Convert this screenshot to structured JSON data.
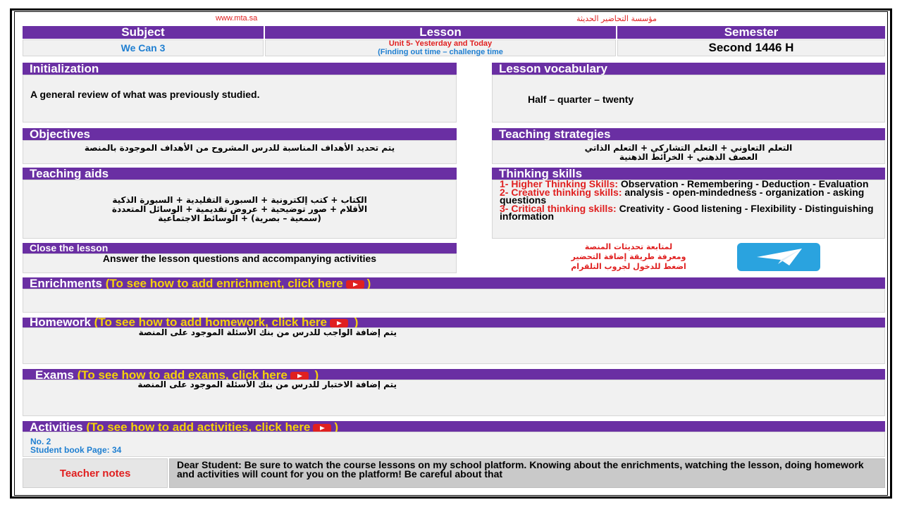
{
  "top": {
    "site": "www.mta.sa",
    "org": "مؤسسة التحاضير الحديثة"
  },
  "headers": {
    "subject": "Subject",
    "lesson": "Lesson",
    "semester": "Semester"
  },
  "info": {
    "subject": "We Can 3",
    "lesson_line1": "Unit 5- Yesterday and Today",
    "lesson_line2": "(Finding out time – challenge time",
    "semester": "Second 1446 H"
  },
  "initialization": {
    "title": "Initialization",
    "text": "A general review of what was previously studied."
  },
  "vocabulary": {
    "title": "Lesson vocabulary",
    "text": "Half – quarter – twenty"
  },
  "objectives": {
    "title": "Objectives",
    "text": "يتم تحديد الأهداف المناسبة للدرس المشروح من الأهداف الموجودة بالمنصة"
  },
  "strategies": {
    "title": "Teaching strategies",
    "line1": "التعلم التعاوني + التعلم التشاركي + التعلم الذاتي",
    "line2": "العصف الذهني + الخرائط الذهنية"
  },
  "aids": {
    "title": "Teaching aids",
    "line1": "الكتاب + كتب إلكترونية + السبورة التقليدية + السبورة الذكية",
    "line2": "الأقلام + صور توضيحية + عروض تقديمية + الوسائل المتعددة",
    "line3": "(سمعية – بصرية) + الوسائط الاجتماعية"
  },
  "thinking": {
    "title": "Thinking skills",
    "s1_label": "1- Higher Thinking Skills:",
    "s1_text": " Observation - Remembering - Deduction - Evaluation",
    "s2_label": "2- Creative thinking skills:",
    "s2_text": " analysis - open-mindedness - organization - asking questions",
    "s3_label": "3- Critical thinking skills:",
    "s3_text": " Creativity - Good listening - Flexibility - Distinguishing information"
  },
  "close": {
    "title": "Close the lesson",
    "text": "Answer the lesson questions and accompanying activities"
  },
  "telegram": {
    "line1": "لمتابعة تحديثات المنصة",
    "line2": "ومعرفة طريقة إضافة التحضير",
    "line3": "اضغط للدخول لجروب التلقرام",
    "icon": "telegram-icon"
  },
  "enrichments": {
    "title": "Enrichments",
    "link": "(To see how to add enrichment, click here",
    "close": ")"
  },
  "homework": {
    "title": "Homework",
    "link": "(To see how to add homework, click here",
    "close": " )",
    "text": "يتم إضافة الواجب للدرس من بنك الأسئلة الموجود على المنصة"
  },
  "exams": {
    "title": "Exams",
    "link": "(To see how to add exams, click here",
    "close": " )",
    "text": "يتم إضافة الاختبار للدرس من بنك الأسئلة الموجود على المنصة"
  },
  "activities": {
    "title": "Activities",
    "link": "(To see how to add activities, click here",
    "close": ")",
    "line1": "No. 2",
    "line2": "Student book Page: 34"
  },
  "notes": {
    "label": "Teacher notes",
    "text": "Dear Student: Be sure to watch the course lessons on my school platform. Knowing about the enrichments, watching the lesson, doing homework and activities will count for you on the platform! Be careful about that"
  },
  "colors": {
    "purple": "#6a2fa3",
    "red": "#e02020",
    "gold": "#f5d20a",
    "blue": "#1f7fd1",
    "telegram": "#2aa3df"
  }
}
